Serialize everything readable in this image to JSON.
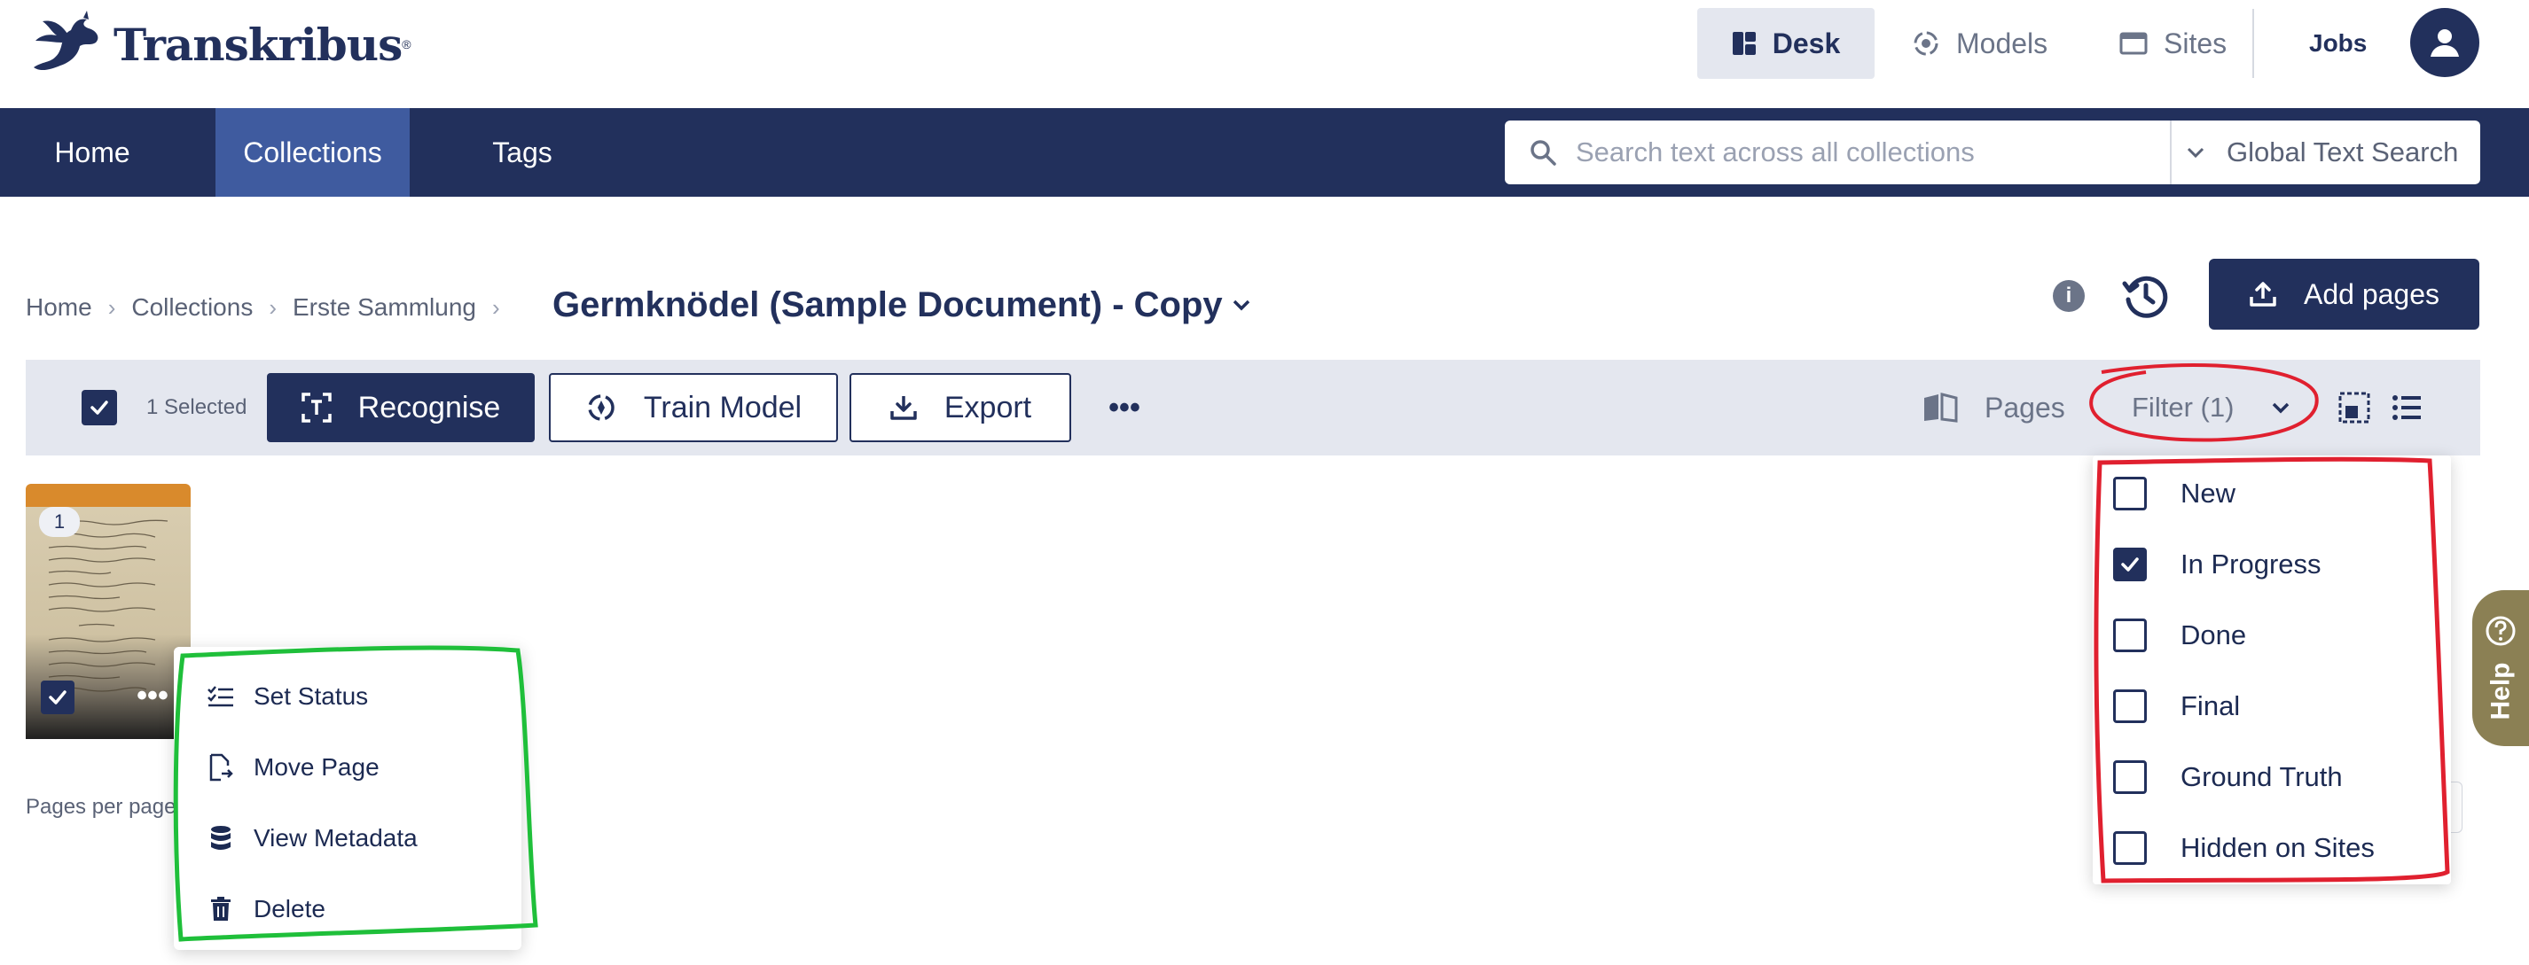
{
  "app": {
    "logo_text": "Transkribus"
  },
  "topnav": {
    "desk": "Desk",
    "models": "Models",
    "sites": "Sites",
    "jobs": "Jobs"
  },
  "mainnav": {
    "items": [
      {
        "label": "Home"
      },
      {
        "label": "Collections"
      },
      {
        "label": "Tags"
      }
    ],
    "active": "Collections"
  },
  "search": {
    "placeholder": "Search text across all collections",
    "scope": "Global Text Search"
  },
  "breadcrumb": [
    "Home",
    "Collections",
    "Erste Sammlung"
  ],
  "document": {
    "title": "Germknödel (Sample Document) - Copy"
  },
  "header_actions": {
    "add_pages": "Add pages"
  },
  "toolbar": {
    "selected": "1 Selected",
    "recognise": "Recognise",
    "train_model": "Train Model",
    "export": "Export",
    "pages": "Pages",
    "filter": "Filter (1)"
  },
  "page_card": {
    "number": "1"
  },
  "pagination": {
    "label": "Pages per page"
  },
  "context_menu": [
    {
      "label": "Set Status",
      "icon": "list-check-icon"
    },
    {
      "label": "Move Page",
      "icon": "move-page-icon"
    },
    {
      "label": "View Metadata",
      "icon": "database-icon"
    },
    {
      "label": "Delete",
      "icon": "trash-icon"
    }
  ],
  "filter_options": [
    {
      "label": "New",
      "checked": false
    },
    {
      "label": "In Progress",
      "checked": true
    },
    {
      "label": "Done",
      "checked": false
    },
    {
      "label": "Final",
      "checked": false
    },
    {
      "label": "Ground Truth",
      "checked": false
    },
    {
      "label": "Hidden on Sites",
      "checked": false
    }
  ],
  "help": {
    "label": "Help"
  },
  "colors": {
    "navy": "#22305c",
    "nav_active": "#3f5b9f",
    "toolbar_bg": "#e4e7ef",
    "status_orange": "#d98a2c",
    "help_bg": "#8b8054",
    "annotation_red": "#e0202f",
    "annotation_green": "#1fbf3a"
  }
}
